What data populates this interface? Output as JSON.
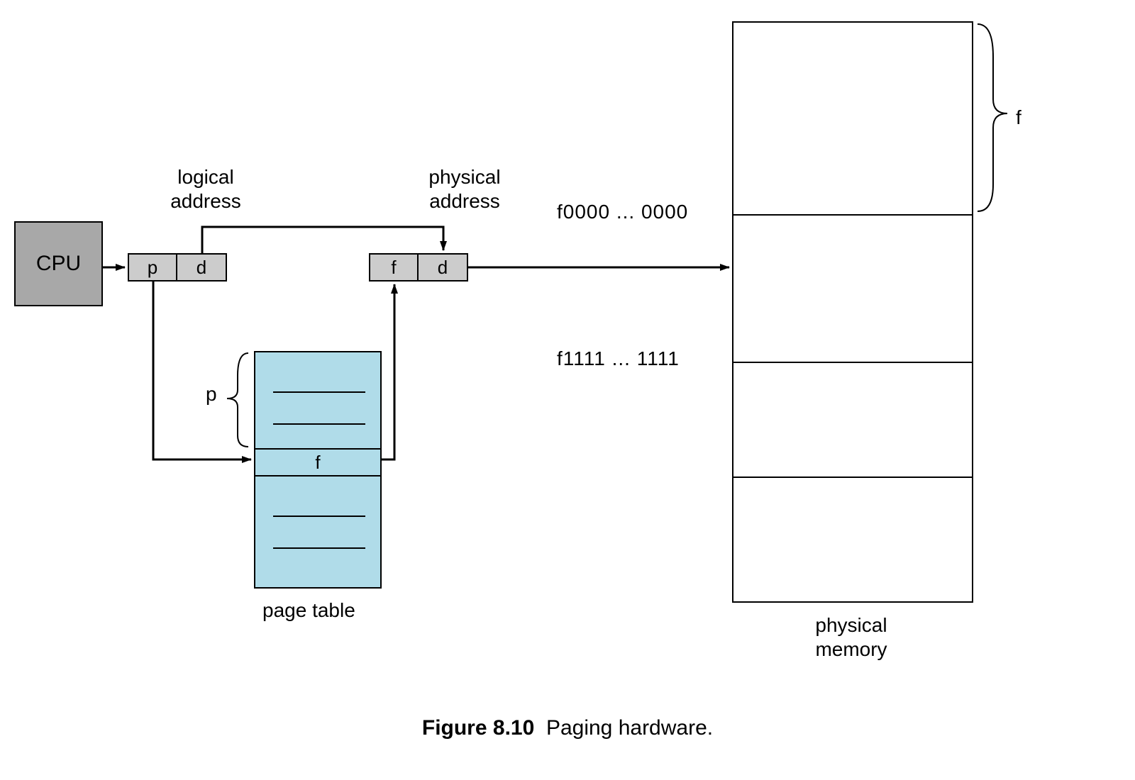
{
  "cpu": {
    "label": "CPU"
  },
  "logical": {
    "label_line1": "logical",
    "label_line2": "address",
    "p": "p",
    "d": "d"
  },
  "physical": {
    "label_line1": "physical",
    "label_line2": "address",
    "f": "f",
    "d": "d"
  },
  "pagetable": {
    "label": "page table",
    "f": "f",
    "p_brace": "p"
  },
  "memory": {
    "label_line1": "physical",
    "label_line2": "memory",
    "frame_top": "f0000 ... 0000",
    "frame_bot": "f1111 ... 1111",
    "f_brace": "f"
  },
  "caption": {
    "bold": "Figure 8.10",
    "text": "Paging hardware."
  }
}
